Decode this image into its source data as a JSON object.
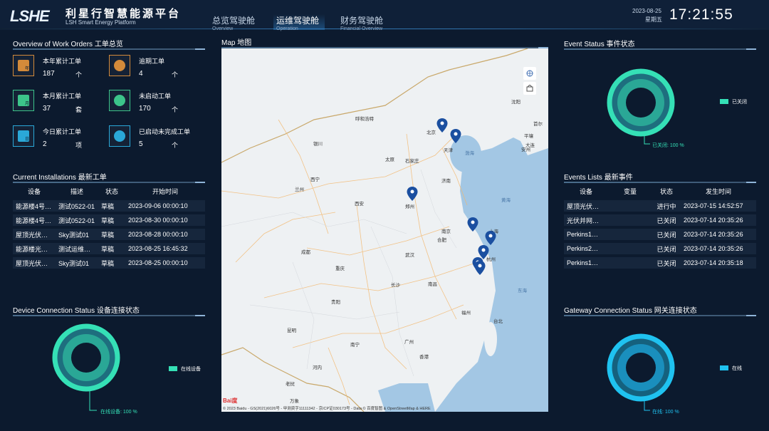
{
  "header": {
    "logo": "LSHE",
    "title_cn": "利星行智慧能源平台",
    "title_en": "LSH Smart Energy Platform",
    "tabs": [
      {
        "cn": "总览驾驶舱",
        "en": "Overview"
      },
      {
        "cn": "运维驾驶舱",
        "en": "Operation"
      },
      {
        "cn": "财务驾驶舱",
        "en": "Financial Overview"
      }
    ],
    "date": "2023-08-25",
    "weekday": "星期五",
    "time": "17:21:55"
  },
  "work_orders": {
    "title": "Overview of Work Orders 工单总览",
    "items": [
      {
        "label": "本年累计工单",
        "value": "187",
        "unit": "个",
        "icon_char": "年",
        "color": "#d38a3a"
      },
      {
        "label": "逾期工单",
        "value": "4",
        "unit": "个",
        "icon_char": "",
        "color": "#d38a3a"
      },
      {
        "label": "本月累计工单",
        "value": "37",
        "unit": "套",
        "icon_char": "月",
        "color": "#3cc48a"
      },
      {
        "label": "未启动工单",
        "value": "170",
        "unit": "个",
        "icon_char": "",
        "color": "#3cc48a"
      },
      {
        "label": "今日累计工单",
        "value": "2",
        "unit": "项",
        "icon_char": "日",
        "color": "#2aa8d8"
      },
      {
        "label": "已启动未完成工单",
        "value": "5",
        "unit": "个",
        "icon_char": "",
        "color": "#2aa8d8"
      }
    ]
  },
  "installations": {
    "title": "Current Installations 最新工单",
    "columns": [
      "设备",
      "描述",
      "状态",
      "开始时间"
    ],
    "rows": [
      [
        "能源楼4号…",
        "测试0522-01",
        "草稿",
        "2023-09-06 00:00:10"
      ],
      [
        "能源楼4号…",
        "测试0522-01",
        "草稿",
        "2023-08-30 00:00:10"
      ],
      [
        "屋顶光伏…",
        "Sky测试01",
        "草稿",
        "2023-08-28 00:00:10"
      ],
      [
        "能源楼光…",
        "测试运维…",
        "草稿",
        "2023-08-25 16:45:32"
      ],
      [
        "屋顶光伏…",
        "Sky测试01",
        "草稿",
        "2023-08-25 00:00:10"
      ]
    ]
  },
  "device_status": {
    "title": "Device Connection Status 设备连接状态",
    "legend": "在线设备",
    "pct_label": "在线设备: 100 %",
    "percent": 100,
    "color": "#35e0b6"
  },
  "map": {
    "title": "Map 地图",
    "cities": [
      "呼和浩特",
      "北京",
      "天津",
      "沈阳",
      "银川",
      "太原",
      "石家庄",
      "西宁",
      "兰州",
      "济南",
      "西安",
      "郑州",
      "合肥",
      "南京",
      "上海",
      "成都",
      "武汉",
      "杭州",
      "重庆",
      "长沙",
      "南昌",
      "贵阳",
      "福州",
      "台北",
      "昆明",
      "南宁",
      "广州",
      "香港",
      "河内",
      "老挝",
      "万象",
      "渤海",
      "黄海",
      "东海",
      "安州",
      "平壤",
      "首尔",
      "大连"
    ],
    "copyright": "© 2023 Baidu - GS(2021)6026号 - 甲测资字11111342 - 京ICP证030173号 - Data © 百度智图 & OpenStreetMap & HERE",
    "baidu_logo": "Bai度"
  },
  "event_status": {
    "title": "Event Status 事件状态",
    "legend": "已关闭",
    "pct_label": "已关闭: 100 %",
    "percent": 100,
    "color": "#35e0b6"
  },
  "events": {
    "title": "Events Lists 最新事件",
    "columns": [
      "设备",
      "变量",
      "状态",
      "发生时间"
    ],
    "rows": [
      {
        "device": "屋顶光伏…",
        "variable": "",
        "status": "进行中",
        "time": "2023-07-15 14:52:57",
        "kind": "ing"
      },
      {
        "device": "光伏并网…",
        "variable": "",
        "status": "已关闭",
        "time": "2023-07-14 20:35:26",
        "kind": "closed"
      },
      {
        "device": "Perkins1…",
        "variable": "",
        "status": "已关闭",
        "time": "2023-07-14 20:35:26",
        "kind": "closed"
      },
      {
        "device": "Perkins2…",
        "variable": "",
        "status": "已关闭",
        "time": "2023-07-14 20:35:26",
        "kind": "closed"
      },
      {
        "device": "Perkins1…",
        "variable": "",
        "status": "已关闭",
        "time": "2023-07-14 20:35:18",
        "kind": "closed"
      }
    ]
  },
  "gateway_status": {
    "title": "Gateway Connection Status 网关连接状态",
    "legend": "在线",
    "pct_label": "在线: 100 %",
    "percent": 100,
    "color": "#1fc2f0"
  },
  "colors": {
    "background": "#0c1a2e",
    "panel_row": "#16263c",
    "accent": "#2f82c8",
    "marker": "#1b4fa0"
  }
}
